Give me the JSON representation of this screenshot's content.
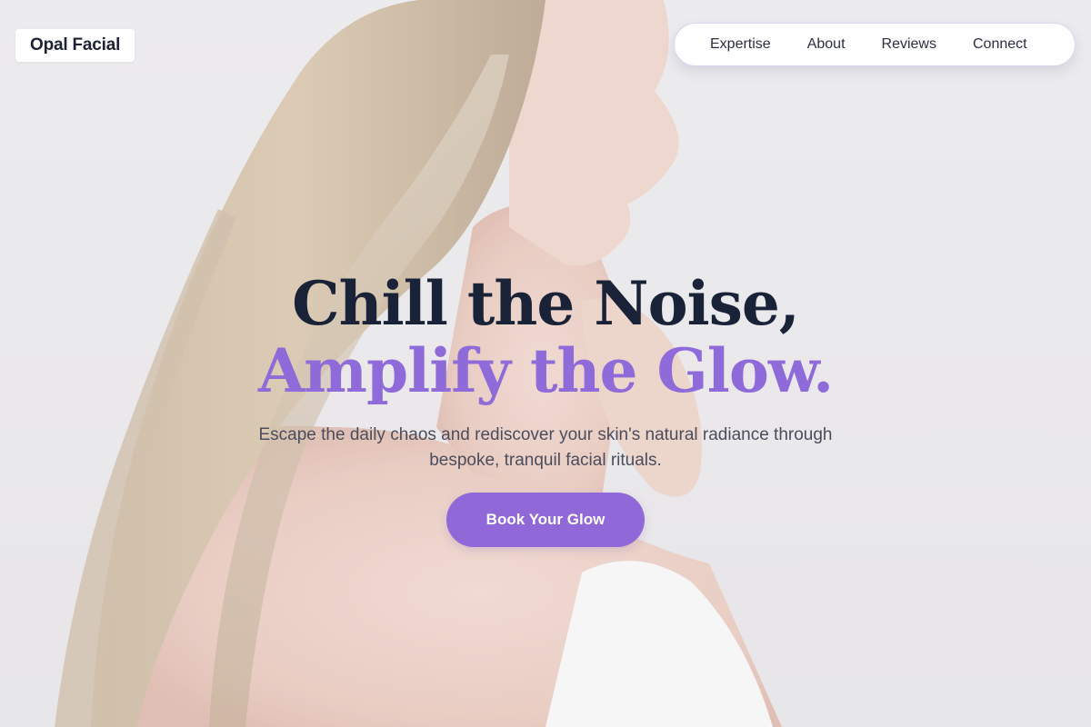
{
  "brand": {
    "name": "Opal Facial"
  },
  "nav": {
    "items": [
      {
        "label": "Expertise"
      },
      {
        "label": "About"
      },
      {
        "label": "Reviews"
      },
      {
        "label": "Connect"
      }
    ]
  },
  "hero": {
    "headline_line1": "Chill the Noise,",
    "headline_line2": "Amplify the Glow.",
    "subtitle": "Escape the daily chaos and rediscover your skin's natural radiance through bespoke, tranquil facial rituals.",
    "cta_label": "Book Your Glow",
    "image_alt": "woman with long hair touching her neck"
  },
  "colors": {
    "accent": "#9068d8",
    "heading_dark": "#1a2238",
    "background": "#e9e8ea"
  }
}
